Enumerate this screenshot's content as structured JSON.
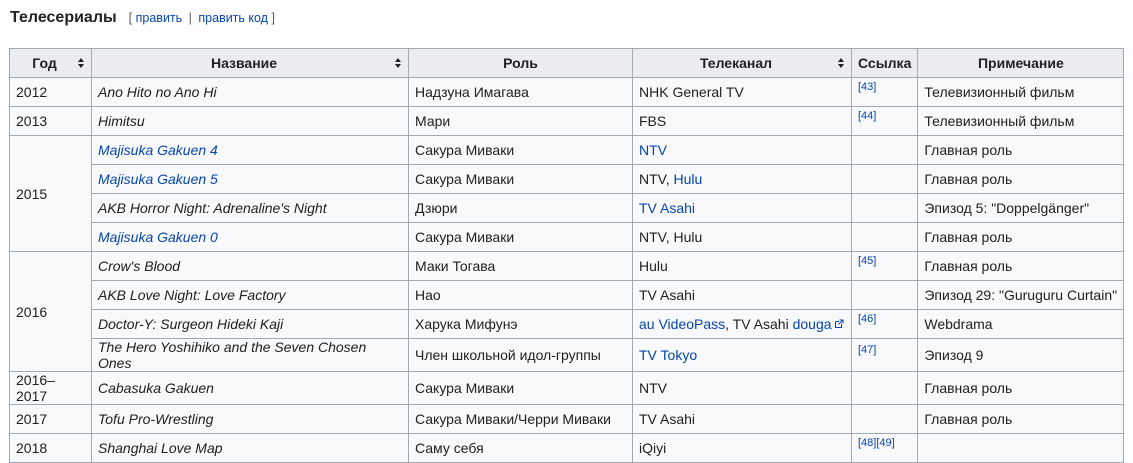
{
  "section": {
    "title": "Телесериалы",
    "edit_open": "[",
    "edit_label": "править",
    "separator": "|",
    "edit_code_label": "править код",
    "edit_close": "]"
  },
  "table": {
    "headers": {
      "year": "Год",
      "title": "Название",
      "role": "Роль",
      "channel": "Телеканал",
      "ref": "Ссылка",
      "note": "Примечание"
    },
    "rows": [
      {
        "year": "2012",
        "title": "Ano Hito no Ano Hi",
        "role": "Надзуна Имагава",
        "channel": "NHK General TV",
        "ref": "[43]",
        "note": "Телевизионный фильм"
      },
      {
        "year": "2013",
        "title": "Himitsu",
        "role": "Мари",
        "channel": "FBS",
        "ref": "[44]",
        "note": "Телевизионный фильм"
      },
      {
        "year": "2015",
        "title": "Majisuka Gakuen 4",
        "role": "Сакура Миваки",
        "channel": "NTV",
        "ref": "",
        "note": "Главная роль"
      },
      {
        "title": "Majisuka Gakuen 5",
        "role": "Сакура Миваки",
        "channel_a": "NTV,",
        "channel_b": "Hulu",
        "ref": "",
        "note": "Главная роль"
      },
      {
        "title": "AKB Horror Night: Adrenaline's Night",
        "role": "Дзюри",
        "channel": "TV Asahi",
        "ref": "",
        "note": "Эпизод 5: \"Doppelgänger\""
      },
      {
        "title": "Majisuka Gakuen 0",
        "role": "Сакура Миваки",
        "channel": "NTV, Hulu",
        "ref": "",
        "note": "Главная роль"
      },
      {
        "year": "2016",
        "title": "Crow's Blood",
        "role": "Маки Тогава",
        "channel": "Hulu",
        "ref": "[45]",
        "note": "Главная роль"
      },
      {
        "title": "AKB Love Night: Love Factory",
        "role": "Нао",
        "channel": "TV Asahi",
        "ref": "",
        "note": "Эпизод 29: \"Guruguru Curtain\""
      },
      {
        "title": "Doctor-Y: Surgeon Hideki Kaji",
        "role": "Харука Мифунэ",
        "channel_a": "au VideoPass",
        "channel_b": ", TV Asahi",
        "channel_c": "douga",
        "ref": "[46]",
        "note": "Webdrama"
      },
      {
        "title": "The Hero Yoshihiko and the Seven Chosen Ones",
        "role": "Член школьной идол-группы",
        "channel": "TV Tokyo",
        "ref": "[47]",
        "note": "Эпизод 9"
      },
      {
        "year": "2016–2017",
        "title": "Cabasuka Gakuen",
        "role": "Сакура Миваки",
        "channel": "NTV",
        "ref": "",
        "note": "Главная роль"
      },
      {
        "year": "2017",
        "title": "Tofu Pro-Wrestling",
        "role": "Сакура Миваки/Черри Миваки",
        "channel": "TV Asahi",
        "ref": "",
        "note": "Главная роль"
      },
      {
        "year": "2018",
        "title": "Shanghai Love Map",
        "role": "Саму себя",
        "channel": "iQiyi",
        "ref_a": "[48]",
        "ref_b": "[49]",
        "note": ""
      }
    ]
  },
  "icons": {
    "sort": "sort-icon",
    "external": "external-link-icon"
  }
}
